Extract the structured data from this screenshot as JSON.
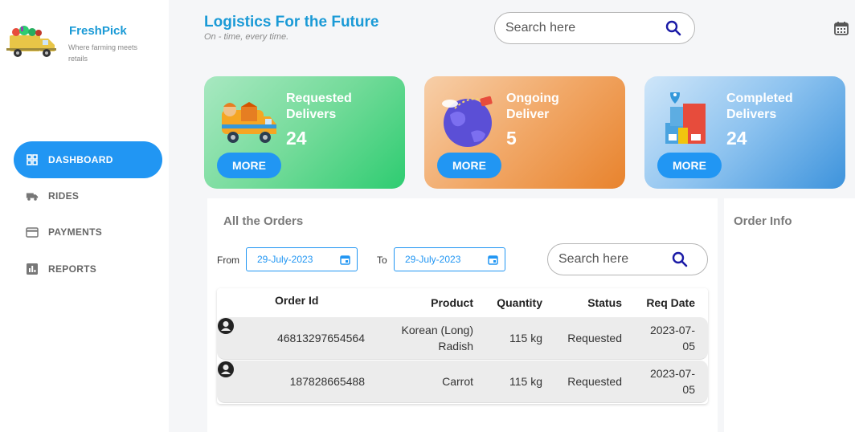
{
  "brand": {
    "name": "FreshPick",
    "tagline": "Where farming meets retails"
  },
  "nav": [
    {
      "label": "DASHBOARD",
      "icon": "grid-icon",
      "active": true
    },
    {
      "label": "RIDES",
      "icon": "truck-icon",
      "active": false
    },
    {
      "label": "PAYMENTS",
      "icon": "credit-card-icon",
      "active": false
    },
    {
      "label": "REPORTS",
      "icon": "bar-chart-icon",
      "active": false
    }
  ],
  "header": {
    "title": "Logistics For the Future",
    "subtitle": "On - time, every time.",
    "search_placeholder": "Search here"
  },
  "cards": [
    {
      "label": "Requested Delivers",
      "count": "24",
      "button": "MORE",
      "color": "#2ecc71"
    },
    {
      "label": "Ongoing Deliver",
      "count": "5",
      "button": "MORE",
      "color": "#e8832d"
    },
    {
      "label": "Completed Delivers",
      "count": "24",
      "button": "MORE",
      "color": "#3d93dc"
    }
  ],
  "orders": {
    "title": "All the Orders",
    "from_label": "From",
    "from_date": "29-July-2023",
    "to_label": "To",
    "to_date": "29-July-2023",
    "search_placeholder": "Search here",
    "columns": [
      "Order Id",
      "Product",
      "Quantity",
      "Status",
      "Req Date"
    ],
    "rows": [
      {
        "order_id": "46813297654564",
        "product_line1": "Korean (Long)",
        "product_line2": "Radish",
        "quantity": "115 kg",
        "status": "Requested",
        "date_line1": "2023-07-",
        "date_line2": "05"
      },
      {
        "order_id": "187828665488",
        "product_line1": "Carrot",
        "product_line2": "",
        "quantity": "115 kg",
        "status": "Requested",
        "date_line1": "2023-07-",
        "date_line2": "05"
      }
    ]
  },
  "info": {
    "title": "Order Info"
  },
  "colors": {
    "accent": "#2196f3",
    "brand": "#1a9ad6"
  }
}
